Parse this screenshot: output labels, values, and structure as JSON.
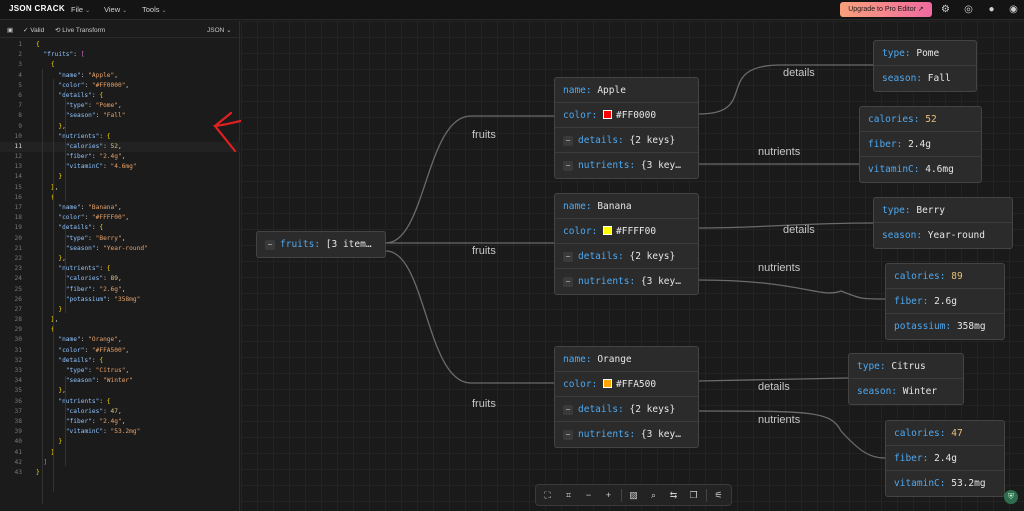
{
  "app": {
    "brand": "JSON CRACK",
    "menus": [
      "File",
      "View",
      "Tools"
    ],
    "upgrade_label": "Upgrade to Pro Editor",
    "icons": [
      "gear-icon",
      "chrome-icon",
      "github-icon",
      "discord-icon"
    ]
  },
  "editor": {
    "valid_label": "Valid",
    "live_transform_label": "Live Transform",
    "format_label": "JSON",
    "active_line": 11,
    "lines": [
      "{",
      "  \"fruits\": [",
      "    {",
      "      \"name\": \"Apple\",",
      "      \"color\": \"#FF0000\",",
      "      \"details\": {",
      "        \"type\": \"Pome\",",
      "        \"season\": \"Fall\"",
      "      },",
      "      \"nutrients\": {",
      "        \"calories\": 52,",
      "        \"fiber\": \"2.4g\",",
      "        \"vitaminC\": \"4.6mg\"",
      "      }",
      "    },",
      "    {",
      "      \"name\": \"Banana\",",
      "      \"color\": \"#FFFF00\",",
      "      \"details\": {",
      "        \"type\": \"Berry\",",
      "        \"season\": \"Year-round\"",
      "      },",
      "      \"nutrients\": {",
      "        \"calories\": 89,",
      "        \"fiber\": \"2.6g\",",
      "        \"potassium\": \"358mg\"",
      "      }",
      "    },",
      "    {",
      "      \"name\": \"Orange\",",
      "      \"color\": \"#FFA500\",",
      "      \"details\": {",
      "        \"type\": \"Citrus\",",
      "        \"season\": \"Winter\"",
      "      },",
      "      \"nutrients\": {",
      "        \"calories\": 47,",
      "        \"fiber\": \"2.4g\",",
      "        \"vitaminC\": \"53.2mg\"",
      "      }",
      "    }",
      "  ]",
      "}"
    ]
  },
  "graph": {
    "root": {
      "key": "fruits",
      "value": "[3 item…"
    },
    "edge_labels": {
      "fruits": "fruits",
      "details": "details",
      "nutrients": "nutrients"
    },
    "fruits": [
      {
        "name": "Apple",
        "color": "#FF0000",
        "details_summary": "{2 keys}",
        "nutrients_summary": "{3 key…",
        "details": [
          {
            "k": "type",
            "v": "Pome"
          },
          {
            "k": "season",
            "v": "Fall"
          }
        ],
        "nutrients": [
          {
            "k": "calories",
            "v": "52",
            "num": true
          },
          {
            "k": "fiber",
            "v": "2.4g"
          },
          {
            "k": "vitaminC",
            "v": "4.6mg"
          }
        ]
      },
      {
        "name": "Banana",
        "color": "#FFFF00",
        "details_summary": "{2 keys}",
        "nutrients_summary": "{3 key…",
        "details": [
          {
            "k": "type",
            "v": "Berry"
          },
          {
            "k": "season",
            "v": "Year-round"
          }
        ],
        "nutrients": [
          {
            "k": "calories",
            "v": "89",
            "num": true
          },
          {
            "k": "fiber",
            "v": "2.6g"
          },
          {
            "k": "potassium",
            "v": "358mg"
          }
        ]
      },
      {
        "name": "Orange",
        "color": "#FFA500",
        "details_summary": "{2 keys}",
        "nutrients_summary": "{3 key…",
        "details": [
          {
            "k": "type",
            "v": "Citrus"
          },
          {
            "k": "season",
            "v": "Winter"
          }
        ],
        "nutrients": [
          {
            "k": "calories",
            "v": "47",
            "num": true
          },
          {
            "k": "fiber",
            "v": "2.4g"
          },
          {
            "k": "vitaminC",
            "v": "53.2mg"
          }
        ]
      }
    ]
  },
  "colors": {
    "accent_key": "#4ea8f0",
    "number": "#e6c07b",
    "annotation": "#e02020"
  },
  "bottom_toolbar": [
    "fit-view-icon",
    "focus-icon",
    "zoom-out-icon",
    "zoom-in-icon",
    "image-icon",
    "search-icon",
    "swap-icon",
    "copy-icon",
    "settings-icon"
  ]
}
